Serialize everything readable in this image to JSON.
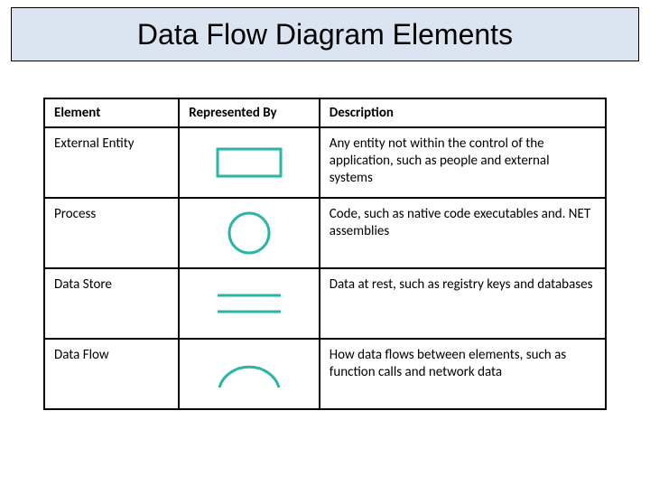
{
  "title": "Data Flow Diagram Elements",
  "headers": {
    "element": "Element",
    "represented": "Represented By",
    "description": "Description"
  },
  "rows": [
    {
      "element": "External Entity",
      "icon": "rectangle-icon",
      "description": "Any entity not within the control of the application, such as people and external systems"
    },
    {
      "element": "Process",
      "icon": "circle-icon",
      "description": "Code, such as native code executables and. NET assemblies"
    },
    {
      "element": "Data Store",
      "icon": "parallel-lines-icon",
      "description": "Data at rest, such as registry keys and databases"
    },
    {
      "element": "Data Flow",
      "icon": "arc-icon",
      "description": "How data flows between elements, such as function calls and network data"
    }
  ]
}
